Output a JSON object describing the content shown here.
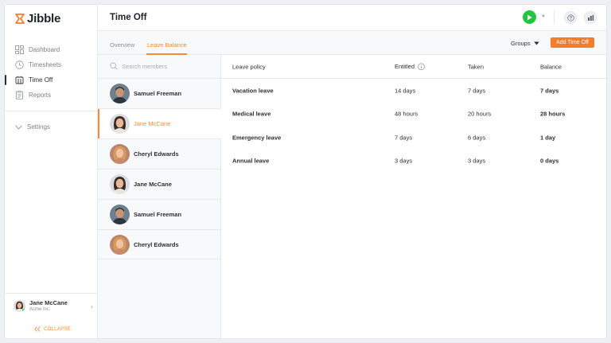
{
  "brand": {
    "name": "Jibble",
    "accent": "#f28a3a",
    "button_color": "#f57c2b",
    "play_color": "#23c53e"
  },
  "sidebar": {
    "items": [
      {
        "label": "Dashboard",
        "icon": "dashboard-icon",
        "active": false
      },
      {
        "label": "Timesheets",
        "icon": "clock-icon",
        "active": false
      },
      {
        "label": "Time Off",
        "icon": "time-off-icon",
        "active": true
      },
      {
        "label": "Reports",
        "icon": "reports-icon",
        "active": false
      }
    ],
    "settings_label": "Settings",
    "user": {
      "name": "Jane McCane",
      "org": "Acme Inc."
    },
    "collapse_label": "COLLAPSE"
  },
  "header": {
    "title": "Time Off"
  },
  "subbar": {
    "tabs": [
      {
        "label": "Overview"
      },
      {
        "label": "Leave Balance"
      }
    ],
    "active_tab": "Leave Balance",
    "groups_label": "Groups",
    "add_button": "Add Time Off"
  },
  "members": {
    "search_placeholder": "Search members",
    "list": [
      {
        "name": "Samuel Freeman"
      },
      {
        "name": "Jane McCane"
      },
      {
        "name": "Cheryl Edwards"
      },
      {
        "name": "Jane McCane"
      },
      {
        "name": "Samuel Freeman"
      },
      {
        "name": "Cheryl Edwards"
      }
    ],
    "active_index": 1
  },
  "table": {
    "headers": {
      "policy": "Leave policy",
      "entitled": "Entitled",
      "taken": "Taken",
      "balance": "Balance"
    },
    "rows": [
      {
        "policy": "Vacation leave",
        "entitled": "14 days",
        "taken": "7 days",
        "balance": "7 days"
      },
      {
        "policy": "Medical leave",
        "entitled": "48 hours",
        "taken": "20 hours",
        "balance": "28 hours"
      },
      {
        "policy": "Emergency leave",
        "entitled": "7 days",
        "taken": "6 days",
        "balance": "1 day"
      },
      {
        "policy": "Annual leave",
        "entitled": "3 days",
        "taken": "3 days",
        "balance": "0 days"
      }
    ]
  }
}
